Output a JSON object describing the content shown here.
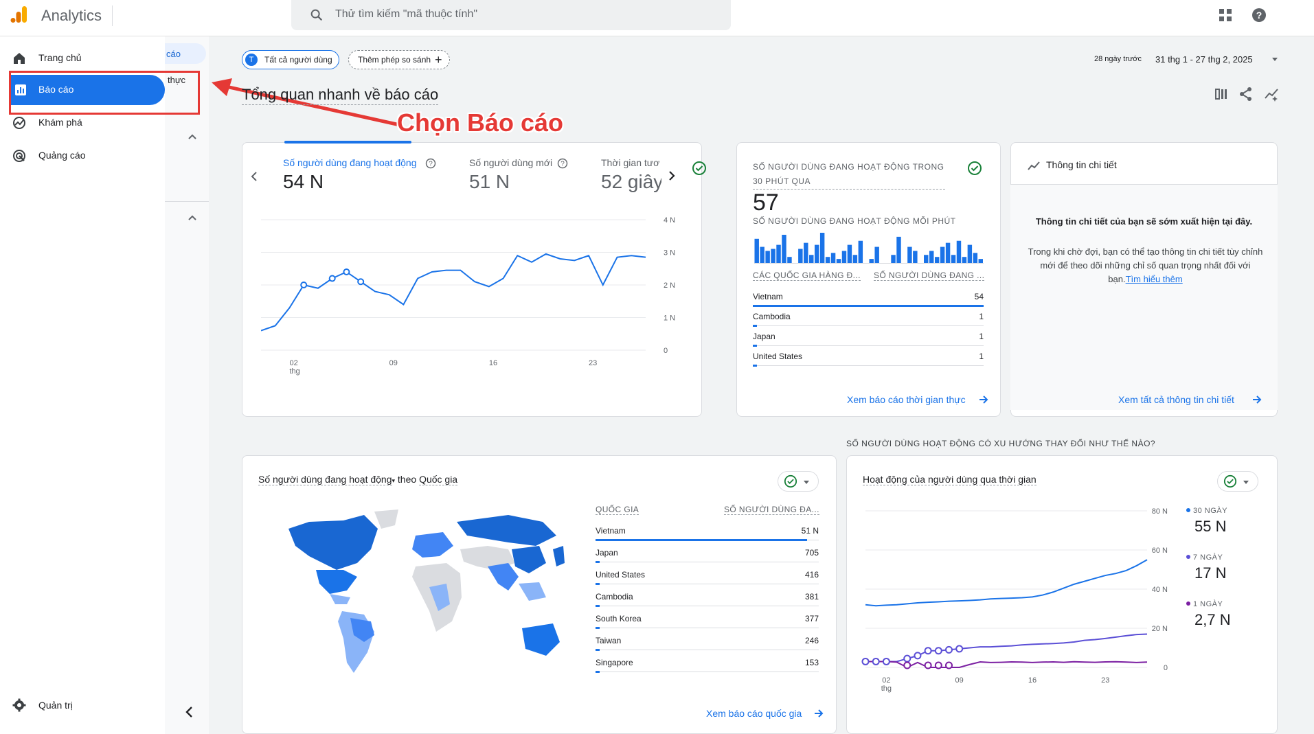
{
  "app": {
    "title": "Analytics"
  },
  "search": {
    "placeholder": "Thử tìm kiếm \"mã thuộc tính\""
  },
  "sidebar": {
    "items": [
      {
        "label": "Trang chủ",
        "icon": "home-icon"
      },
      {
        "label": "Báo cáo",
        "icon": "bar-chart-icon",
        "active": true
      },
      {
        "label": "Khám phá",
        "icon": "explore-icon"
      },
      {
        "label": "Quảng cáo",
        "icon": "ads-icon"
      }
    ],
    "admin_label": "Quản trị",
    "subpanel_item1": "cáo",
    "subpanel_item2": "thực"
  },
  "filters": {
    "audience_avatar": "T",
    "audience": "Tất cả người dùng",
    "compare": "Thêm phép so sánh",
    "date_prefix": "28 ngày trước",
    "date_range": "31 thg 1 - 27 thg 2, 2025"
  },
  "page_title": "Tổng quan nhanh về báo cáo",
  "annotation": "Chọn Báo cáo",
  "overview_card": {
    "metrics": [
      {
        "label": "Số người dùng đang hoạt động",
        "value": "54 N"
      },
      {
        "label": "Số người dùng mới",
        "value": "51 N"
      },
      {
        "label": "Thời gian tươ",
        "value": "52 giây"
      }
    ],
    "y_ticks": [
      "4 N",
      "3 N",
      "2 N",
      "1 N",
      "0"
    ],
    "x_ticks": [
      "02",
      "09",
      "16",
      "23"
    ],
    "x_sub": "thg"
  },
  "realtime_card": {
    "title": "SỐ NGƯỜI DÙNG ĐANG HOẠT ĐỘNG TRONG 30 PHÚT QUA",
    "value": "57",
    "subtitle": "SỐ NGƯỜI DÙNG ĐANG HOẠT ĐỘNG MỖI PHÚT",
    "col1": "CÁC QUỐC GIA HÀNG Đ...",
    "col2": "SỐ NGƯỜI DÙNG ĐANG ...",
    "rows": [
      {
        "country": "Vietnam",
        "users": "54"
      },
      {
        "country": "Cambodia",
        "users": "1"
      },
      {
        "country": "Japan",
        "users": "1"
      },
      {
        "country": "United States",
        "users": "1"
      }
    ],
    "link": "Xem báo cáo thời gian thực",
    "per_minute": [
      12,
      8,
      6,
      7,
      9,
      14,
      3,
      0,
      7,
      10,
      4,
      9,
      15,
      3,
      5,
      2,
      6,
      9,
      4,
      11,
      0,
      2,
      8,
      0,
      0,
      4,
      13,
      0,
      8,
      6,
      0,
      4,
      6,
      3,
      8,
      10,
      4,
      11,
      3,
      9,
      5,
      2
    ]
  },
  "insights_card": {
    "title": "Thông tin chi tiết",
    "heading": "Thông tin chi tiết của bạn sẽ sớm xuất hiện tại đây.",
    "body": "Trong khi chờ đợi, bạn có thể tạo thông tin chi tiết tùy chỉnh mới để theo dõi những chỉ số quan trọng nhất đối với bạn.",
    "learn_more": "Tìm hiểu thêm",
    "link": "Xem tất cả thông tin chi tiết"
  },
  "country_card": {
    "title_metric": "Số người dùng đang hoạt động",
    "title_by": "theo",
    "title_dim": "Quốc gia",
    "col1": "QUỐC GIA",
    "col2": "SỐ NGƯỜI DÙNG ĐA...",
    "rows": [
      {
        "country": "Vietnam",
        "users": "51 N"
      },
      {
        "country": "Japan",
        "users": "705"
      },
      {
        "country": "United States",
        "users": "416"
      },
      {
        "country": "Cambodia",
        "users": "381"
      },
      {
        "country": "South Korea",
        "users": "377"
      },
      {
        "country": "Taiwan",
        "users": "246"
      },
      {
        "country": "Singapore",
        "users": "153"
      }
    ],
    "link": "Xem báo cáo quốc gia"
  },
  "trend_section": "SỐ NGƯỜI DÙNG HOẠT ĐỘNG CÓ XU HƯỚNG THAY ĐỔI NHƯ THẾ NÀO?",
  "trend_card": {
    "title": "Hoạt động của người dùng qua thời gian",
    "y_ticks": [
      "80 N",
      "60 N",
      "40 N",
      "20 N",
      "0"
    ],
    "x_ticks": [
      "02",
      "09",
      "16",
      "23"
    ],
    "x_sub": "thg",
    "legend": [
      {
        "label": "30 NGÀY",
        "value": "55 N",
        "color": "#1a73e8"
      },
      {
        "label": "7 NGÀY",
        "value": "17 N",
        "color": "#5b4fd6"
      },
      {
        "label": "1 NGÀY",
        "value": "2,7 N",
        "color": "#7b1fa2"
      }
    ]
  },
  "chart_data": [
    {
      "type": "line",
      "x": [
        "31/1",
        "1/2",
        "2/2",
        "3/2",
        "4/2",
        "5/2",
        "6/2",
        "7/2",
        "8/2",
        "9/2",
        "10/2",
        "11/2",
        "12/2",
        "13/2",
        "14/2",
        "15/2",
        "16/2",
        "17/2",
        "18/2",
        "19/2",
        "20/2",
        "21/2",
        "22/2",
        "23/2",
        "24/2",
        "25/2",
        "26/2",
        "27/2"
      ],
      "series": [
        {
          "values": [
            600,
            750,
            1300,
            2000,
            1900,
            2200,
            2400,
            2100,
            1800,
            1700,
            1400,
            2200,
            2400,
            2450,
            2450,
            2100,
            1950,
            2200,
            2900,
            2700,
            2950,
            2800,
            2750,
            2900,
            2000,
            2850,
            2900,
            2850
          ]
        }
      ],
      "ylim": [
        0,
        4000
      ],
      "color": "#1a73e8"
    },
    {
      "type": "line",
      "x": [
        "31/1",
        "1/2",
        "2/2",
        "3/2",
        "4/2",
        "5/2",
        "6/2",
        "7/2",
        "8/2",
        "9/2",
        "10/2",
        "11/2",
        "12/2",
        "13/2",
        "14/2",
        "15/2",
        "16/2",
        "17/2",
        "18/2",
        "19/2",
        "20/2",
        "21/2",
        "22/2",
        "23/2",
        "24/2",
        "25/2",
        "26/2",
        "27/2"
      ],
      "series": [
        {
          "name": "30 NGÀY",
          "values": [
            32000,
            31500,
            31800,
            32000,
            32500,
            33000,
            33300,
            33500,
            33800,
            34000,
            34200,
            34500,
            35000,
            35200,
            35400,
            35600,
            36000,
            37000,
            38500,
            40500,
            42500,
            44000,
            45500,
            47000,
            48000,
            49500,
            52000,
            55000
          ]
        },
        {
          "name": "7 NGÀY",
          "values": [
            3000,
            3000,
            3000,
            3000,
            4500,
            6000,
            8500,
            8500,
            9000,
            9500,
            10000,
            10500,
            10500,
            10800,
            11000,
            11500,
            11800,
            12000,
            12200,
            12500,
            13000,
            13800,
            14200,
            14800,
            15500,
            16200,
            16800,
            17000
          ]
        },
        {
          "name": "1 NGÀY",
          "values": [
            3000,
            3000,
            3000,
            2700,
            0,
            2500,
            0,
            0,
            0,
            0,
            1500,
            2800,
            2500,
            2600,
            2800,
            2700,
            2500,
            2700,
            2800,
            2600,
            2900,
            2700,
            2600,
            2800,
            2900,
            2700,
            2500,
            2700
          ]
        }
      ],
      "ylim": [
        0,
        80000
      ]
    }
  ]
}
